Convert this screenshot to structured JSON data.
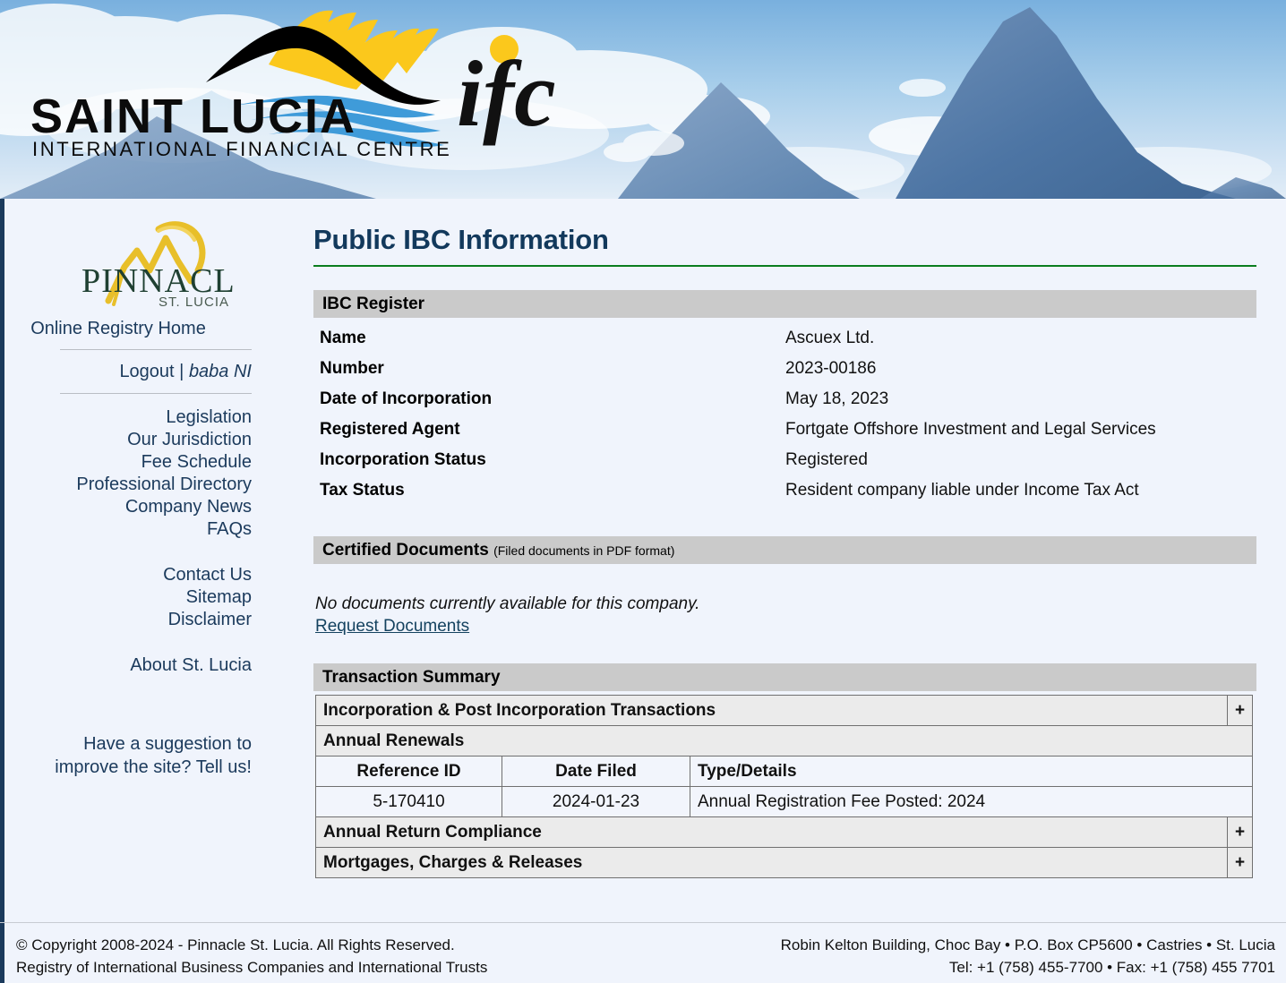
{
  "banner": {
    "logo_title": "SAINT LUCIA",
    "logo_subtitle": "INTERNATIONAL FINANCIAL CENTRE",
    "logo_mark": "ifc",
    "image_alt": "pitons-mountains-photo"
  },
  "sidebar": {
    "logo_word": "PINNACLE",
    "logo_sub": "ST. LUCIA",
    "registry_home": "Online Registry Home",
    "logout_label": "Logout",
    "separator": "|",
    "username": "baba NI",
    "nav": [
      {
        "label": "Legislation",
        "name": "sidebar-item-legislation"
      },
      {
        "label": "Our Jurisdiction",
        "name": "sidebar-item-our-jurisdiction"
      },
      {
        "label": "Fee Schedule",
        "name": "sidebar-item-fee-schedule"
      },
      {
        "label": "Professional Directory",
        "name": "sidebar-item-professional-directory"
      },
      {
        "label": "Company News",
        "name": "sidebar-item-company-news"
      },
      {
        "label": "FAQs",
        "name": "sidebar-item-faqs"
      }
    ],
    "nav2": [
      {
        "label": "Contact Us",
        "name": "sidebar-item-contact-us"
      },
      {
        "label": "Sitemap",
        "name": "sidebar-item-sitemap"
      },
      {
        "label": "Disclaimer",
        "name": "sidebar-item-disclaimer"
      }
    ],
    "nav3": [
      {
        "label": "About St. Lucia",
        "name": "sidebar-item-about-st-lucia"
      }
    ],
    "suggestion_line1": "Have a suggestion to",
    "suggestion_line2": "improve the site? Tell us!"
  },
  "main": {
    "page_title": "Public IBC Information",
    "register_section": {
      "heading": "IBC Register",
      "rows": [
        {
          "key": "Name",
          "value": "Ascuex Ltd."
        },
        {
          "key": "Number",
          "value": "2023-00186"
        },
        {
          "key": "Date of Incorporation",
          "value": "May 18, 2023"
        },
        {
          "key": "Registered Agent",
          "value": "Fortgate Offshore Investment and Legal Services"
        },
        {
          "key": "Incorporation Status",
          "value": "Registered"
        },
        {
          "key": "Tax Status",
          "value": "Resident company liable under Income Tax Act"
        }
      ]
    },
    "documents_section": {
      "heading": "Certified Documents",
      "heading_sub": "(Filed documents in PDF format)",
      "empty_message": "No documents currently available for this company.",
      "request_link": "Request Documents"
    },
    "transactions_section": {
      "heading": "Transaction Summary",
      "groups": [
        {
          "label": "Incorporation & Post Incorporation Transactions",
          "toggle": "+",
          "expanded": false
        },
        {
          "label": "Annual Renewals",
          "toggle": "",
          "expanded": true
        },
        {
          "label": "Annual Return Compliance",
          "toggle": "+",
          "expanded": false
        },
        {
          "label": "Mortgages, Charges & Releases",
          "toggle": "+",
          "expanded": false
        }
      ],
      "columns": [
        "Reference ID",
        "Date Filed",
        "Type/Details"
      ],
      "rows": [
        {
          "reference_id": "5-170410",
          "date_filed": "2024-01-23",
          "type_details": "Annual Registration Fee Posted: 2024"
        }
      ]
    }
  },
  "footer": {
    "left_line1": "© Copyright 2008-2024 - Pinnacle St. Lucia. All Rights Reserved.",
    "left_line2": "Registry of International Business Companies and International Trusts",
    "right_line1": "Robin Kelton Building, Choc Bay • P.O. Box CP5600 • Castries • St. Lucia",
    "right_line2": "Tel: +1 (758) 455-7700 • Fax: +1 (758) 455 7701"
  },
  "colors": {
    "page_bg": "#f0f4fc",
    "left_border": "#1b3a5c",
    "title": "#12395c",
    "title_rule": "#0a7d1e",
    "section_bar": "#cacaca",
    "group_row": "#ebebeb",
    "cell_bg": "#f2f5fc",
    "logo_gold": "#f5c518",
    "logo_green": "#1f4032",
    "link": "#14425f"
  }
}
